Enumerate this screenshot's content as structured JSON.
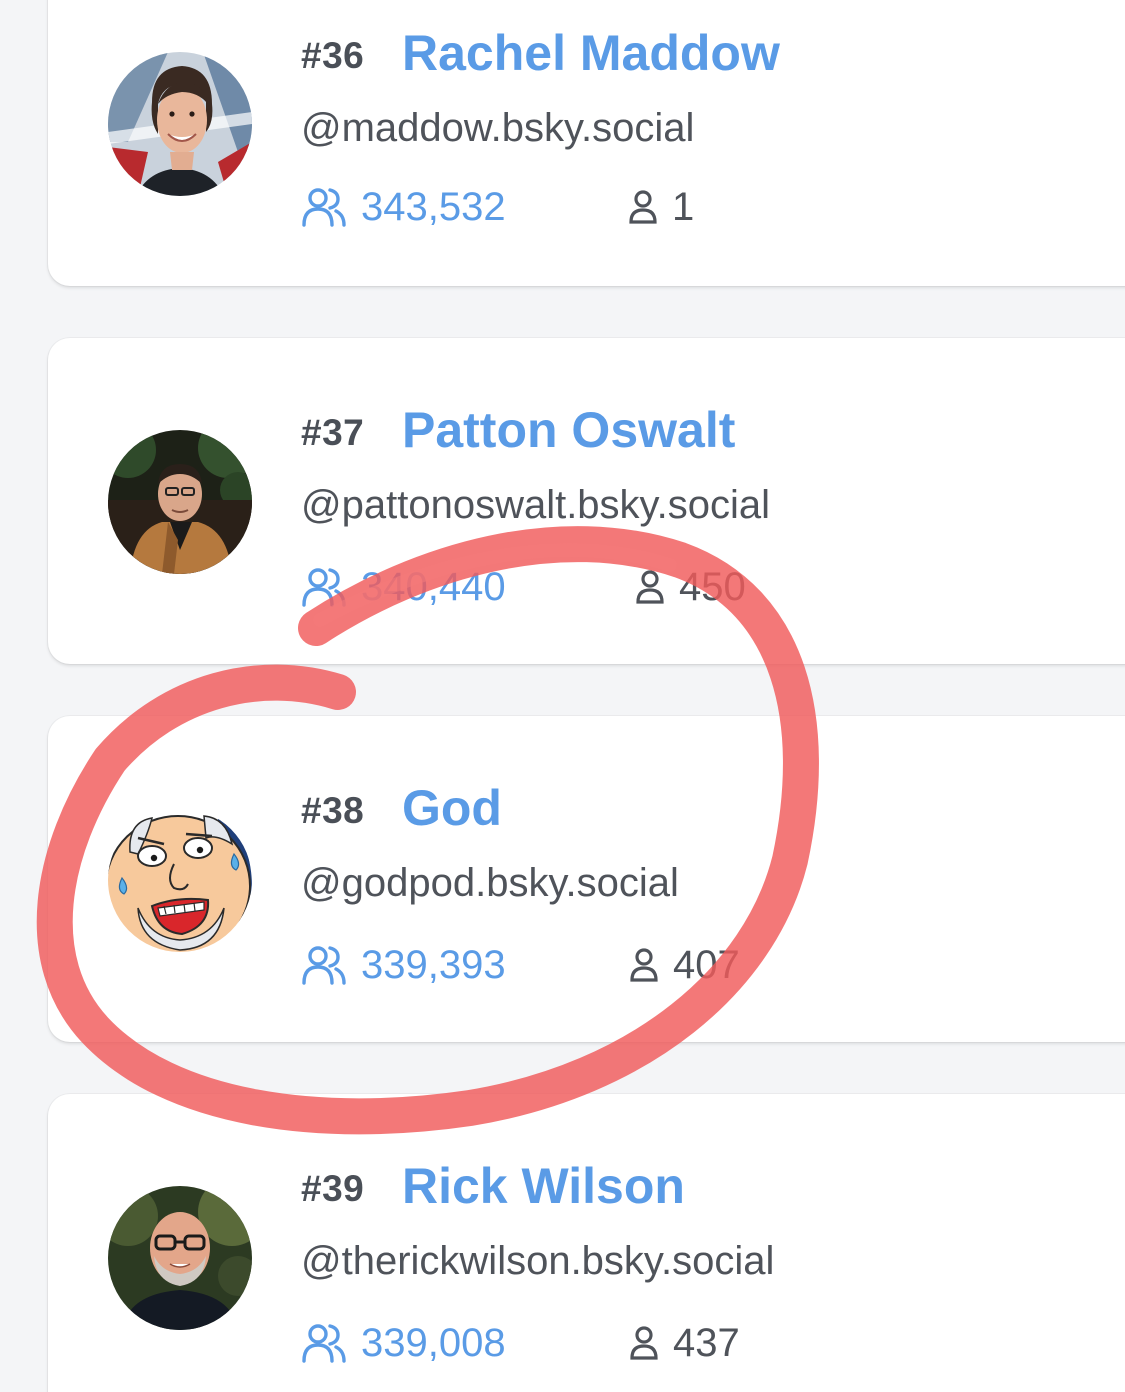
{
  "colors": {
    "accent": "#5a9be6",
    "rank_text": "#4a4f57",
    "secondary_text": "#4f535a",
    "highlight_marker": "#f05a5a",
    "card_background": "#ffffff",
    "page_background": "#f4f5f7"
  },
  "leaderboard": [
    {
      "rank": "#36",
      "name": "Rachel Maddow",
      "handle": "@maddow.bsky.social",
      "followers": "343,532",
      "following": "1",
      "avatar_icon": "rachel-maddow-avatar"
    },
    {
      "rank": "#37",
      "name": "Patton Oswalt",
      "handle": "@pattonoswalt.bsky.social",
      "followers": "340,440",
      "following": "450",
      "avatar_icon": "patton-oswalt-avatar"
    },
    {
      "rank": "#38",
      "name": "God",
      "handle": "@godpod.bsky.social",
      "followers": "339,393",
      "following": "407",
      "avatar_icon": "god-cartoon-avatar",
      "highlighted": true
    },
    {
      "rank": "#39",
      "name": "Rick Wilson",
      "handle": "@therickwilson.bsky.social",
      "followers": "339,008",
      "following": "437",
      "avatar_icon": "rick-wilson-avatar"
    }
  ],
  "icons": {
    "followers": "users-icon",
    "following": "user-icon",
    "highlight": "hand-drawn-red-circle"
  }
}
